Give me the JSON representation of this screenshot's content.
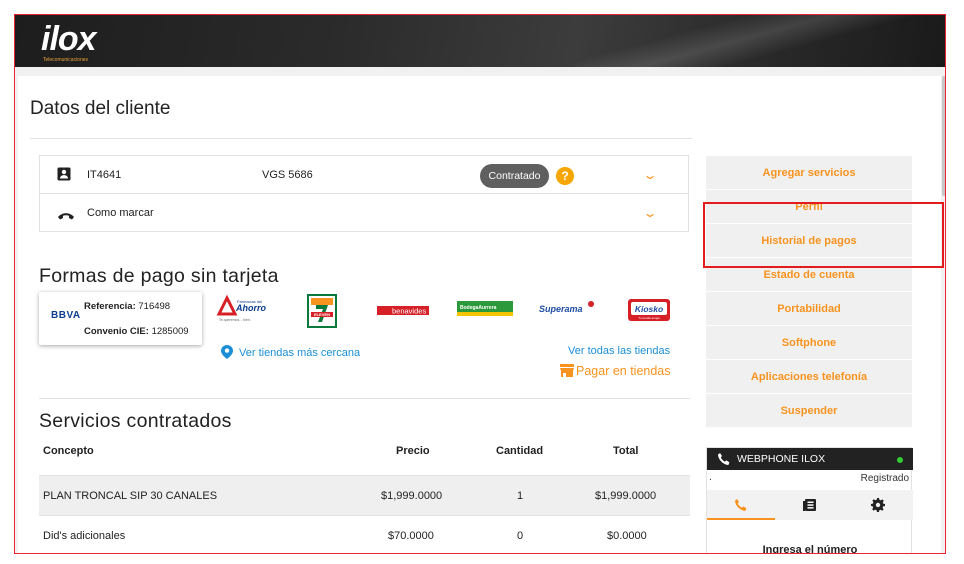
{
  "brand": {
    "logo": "ilox",
    "tagline": "Telecomunicaciones"
  },
  "page": {
    "title": "Datos del cliente"
  },
  "client_card": {
    "row1": {
      "icon": "contact-card-icon",
      "id": "IT4641",
      "name": "VGS 5686",
      "status": "Contratado",
      "help": "?"
    },
    "row2": {
      "icon": "phone-hangup-icon",
      "label": "Como marcar"
    }
  },
  "payment": {
    "title": "Formas de pago sin tarjeta",
    "bbva": {
      "logo": "BBVA",
      "ref_label": "Referencia:",
      "ref_value": "716498",
      "cie_label": "Convenio CIE:",
      "cie_value": "1285009"
    },
    "stores": [
      "Farmacias del Ahorro",
      "7-Eleven",
      "Benavides",
      "Bodega Aurrera",
      "Superama",
      "Kiosko"
    ],
    "store_texts": {
      "ahorro_small": "Farmacias del",
      "ahorro": "Ahorro",
      "ahorro_tag": "Te queremos... bien.",
      "seven": "ELEVEN",
      "benavides": "benavides",
      "aurrera": "BodegaAurrera",
      "superama": "Superama",
      "kiosko": "Kiosko",
      "kiosko_tag": "Tu tienda amiga"
    },
    "link_nearby": "Ver tiendas más cercana",
    "link_all": "Ver todas las tiendas",
    "pay_in_stores": "Pagar en tiendas"
  },
  "services": {
    "title": "Servicios contratados",
    "columns": [
      "Concepto",
      "Precio",
      "Cantidad",
      "Total"
    ],
    "rows": [
      {
        "concepto": "PLAN TRONCAL SIP 30 CANALES",
        "precio": "$1,999.0000",
        "cantidad": "1",
        "total": "$1,999.0000"
      },
      {
        "concepto": "Did's adicionales",
        "precio": "$70.0000",
        "cantidad": "0",
        "total": "$0.0000"
      }
    ]
  },
  "sidebar": {
    "items": [
      "Agregar servicios",
      "Perfil",
      "Historial de pagos",
      "Estado de cuenta",
      "Portabilidad",
      "Softphone",
      "Aplicaciones telefonía",
      "Suspender"
    ]
  },
  "webphone": {
    "title": "WEBPHONE ILOX",
    "status": "Registrado",
    "status_prefix": ".",
    "tabs": [
      "phone-icon",
      "contacts-book-icon",
      "gear-icon"
    ],
    "prompt": "Ingresa el número"
  },
  "colors": {
    "accent": "#f7931e",
    "link": "#1a8fd6",
    "highlight": "#e21c1c",
    "badge": "#5f5f5f"
  }
}
